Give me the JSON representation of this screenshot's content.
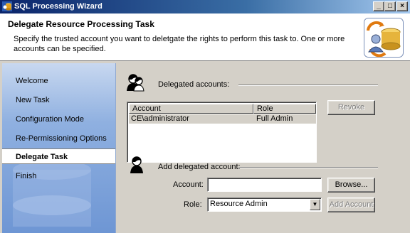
{
  "window": {
    "title": "SQL Processing Wizard"
  },
  "header": {
    "title": "Delegate Resource Processing Task",
    "description": "Specify the trusted account you want to deletgate the rights to perform this task to. One or more accounts can be specified."
  },
  "sidebar": {
    "items": [
      {
        "label": "Welcome",
        "active": false
      },
      {
        "label": "New Task",
        "active": false
      },
      {
        "label": "Configuration Mode",
        "active": false
      },
      {
        "label": "Re-Permissioning Options",
        "active": false
      },
      {
        "label": "Delegate Task",
        "active": true
      },
      {
        "label": "Finish",
        "active": false
      }
    ]
  },
  "delegated": {
    "label": "Delegated accounts:",
    "columns": [
      "Account",
      "Role"
    ],
    "rows": [
      {
        "account": "CE\\administrator",
        "role": "Full Admin"
      }
    ],
    "revoke_label": "Revoke"
  },
  "add": {
    "label": "Add delegated account:",
    "account_label": "Account:",
    "account_value": "",
    "browse_label": "Browse...",
    "role_label": "Role:",
    "role_value": "Resource Admin",
    "add_label": "Add Account"
  }
}
